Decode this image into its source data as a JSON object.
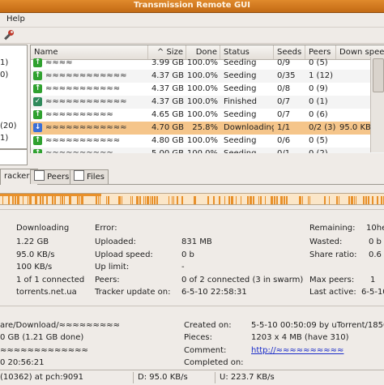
{
  "window": {
    "title": "Transmission Remote GUI"
  },
  "menu": {
    "help": "Help"
  },
  "filters": [
    "1)",
    "0)",
    "",
    "",
    "",
    "",
    "(20)",
    "1)"
  ],
  "table": {
    "columns": {
      "name": "Name",
      "size": "^ Size",
      "done": "Done",
      "status": "Status",
      "seeds": "Seeds",
      "peers": "Peers",
      "down": "Down spee"
    },
    "rows": [
      {
        "name": "≈≈≈≈",
        "size": "3.99 GB",
        "done": "100.0%",
        "status": "Seeding",
        "seeds": "0/9",
        "peers": "0 (5)",
        "down": "",
        "icon": "up"
      },
      {
        "name": "≈≈≈≈≈≈≈≈≈≈≈≈",
        "size": "4.37 GB",
        "done": "100.0%",
        "status": "Seeding",
        "seeds": "0/35",
        "peers": "1 (12)",
        "down": "",
        "icon": "up"
      },
      {
        "name": "≈≈≈≈≈≈≈≈≈≈≈",
        "size": "4.37 GB",
        "done": "100.0%",
        "status": "Seeding",
        "seeds": "0/8",
        "peers": "0 (9)",
        "down": "",
        "icon": "up"
      },
      {
        "name": "≈≈≈≈≈≈≈≈≈≈≈≈",
        "size": "4.37 GB",
        "done": "100.0%",
        "status": "Finished",
        "seeds": "0/7",
        "peers": "0 (1)",
        "down": "",
        "icon": "check"
      },
      {
        "name": "≈≈≈≈≈≈≈≈≈≈",
        "size": "4.65 GB",
        "done": "100.0%",
        "status": "Seeding",
        "seeds": "0/7",
        "peers": "0 (6)",
        "down": "",
        "icon": "up"
      },
      {
        "name": "≈≈≈≈≈≈≈≈≈≈≈≈",
        "size": "4.70 GB",
        "done": "25.8%",
        "status": "Downloading",
        "seeds": "1/1",
        "peers": "0/2 (3)",
        "down": "95.0 KB/s",
        "icon": "down"
      },
      {
        "name": "≈≈≈≈≈≈≈≈≈≈≈",
        "size": "4.80 GB",
        "done": "100.0%",
        "status": "Seeding",
        "seeds": "0/6",
        "peers": "0 (5)",
        "down": "",
        "icon": "up"
      },
      {
        "name": "≈≈≈≈≈≈≈≈≈≈",
        "size": "5.00 GB",
        "done": "100.0%",
        "status": "Seeding",
        "seeds": "0/1",
        "peers": "0 (2)",
        "down": "",
        "icon": "up"
      }
    ],
    "selected_index": 5
  },
  "tabs": {
    "trackers": "rackers",
    "peers": "Peers",
    "files": "Files"
  },
  "info": {
    "status_value": "Downloading",
    "downloaded_value": "1.22 GB",
    "down_speed_value": "95.0 KB/s",
    "down_limit_value": "100 KB/s",
    "seeds_value": "1 of 1 connected",
    "tracker_value": "torrents.net.ua",
    "error_label": "Error:",
    "error_value": "",
    "uploaded_label": "Uploaded:",
    "uploaded_value": "831 MB",
    "upload_speed_label": "Upload speed:",
    "upload_speed_value": "0 b",
    "up_limit_label": "Up limit:",
    "up_limit_value": "-",
    "peers_label": "Peers:",
    "peers_value": "0 of 2 connected (3 in swarm)",
    "tracker_update_label": "Tracker update on:",
    "tracker_update_value": "6-5-10  22:58:31",
    "remaining_label": "Remaining:",
    "remaining_value": "10he",
    "wasted_label": "Wasted:",
    "wasted_value": "0 b",
    "share_ratio_label": "Share ratio:",
    "share_ratio_value": "0.6",
    "max_peers_label": "Max peers:",
    "max_peers_value": "1",
    "last_active_label": "Last active:",
    "last_active_value": "6-5-10"
  },
  "general": {
    "path_value": "are/Download/≈≈≈≈≈≈≈≈≈",
    "size_value": "0 GB (1.21 GB done)",
    "hash_value": "≈≈≈≈≈≈≈≈≈≈≈≈≈",
    "added_value": "0 20:56:21",
    "created_label": "Created on:",
    "created_value": "5-5-10 00:50:09 by uTorrent/1850",
    "pieces_label": "Pieces:",
    "pieces_value": "1203 x 4 MB (have 310)",
    "comment_label": "Comment:",
    "comment_value": "http://≈≈≈≈≈≈≈≈≈≈",
    "completed_label": "Completed on:",
    "completed_value": ""
  },
  "statusbar": {
    "connection": "(10362) at pch:9091",
    "down": "D: 95.0 KB/s",
    "up": "U: 223.7 KB/s"
  },
  "colors": {
    "title_bar": "#d17a1f",
    "selected_row": "#f5c58a",
    "seeding_icon": "#2fa12f",
    "finished_icon": "#2f8a5b",
    "downloading_icon": "#3b6fd6"
  },
  "icons": {
    "toolbar_tool": "wrench-icon"
  }
}
